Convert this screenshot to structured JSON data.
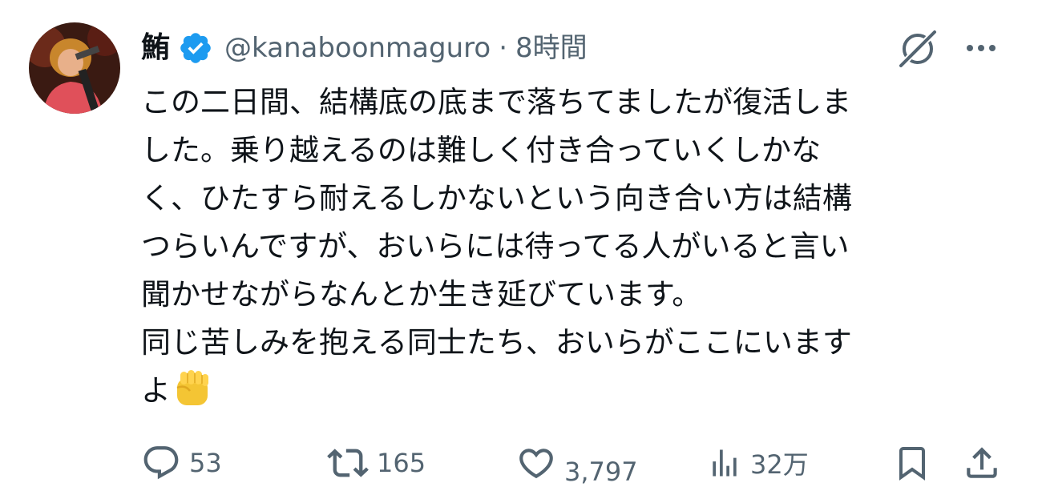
{
  "author": {
    "display_name": "鮪",
    "handle": "@kanaboonmaguro",
    "separator": "·",
    "time": "8時間",
    "verified_color": "#1d9bf0",
    "avatar_icon": "avatar"
  },
  "tweet": {
    "lines": [
      "この二日間、結構底の底まで落ちてましたが復活しま",
      "した。乗り越えるのは難しく付き合っていくしかな",
      "く、ひたすら耐えるしかないという向き合い方は結構",
      "つらいんですが、おいらには待ってる人がいると言い",
      "聞かせながらなんとか生き延びています。",
      "同じ苦しみを抱える同士たち、おいらがここにいます",
      "よ"
    ],
    "emoji": "raised-fist"
  },
  "icons": {
    "grok": "grok-icon",
    "more": "more-icon",
    "reply": "reply-icon",
    "retweet": "retweet-icon",
    "like": "like-icon",
    "views": "views-icon",
    "bookmark": "bookmark-icon",
    "share": "share-icon"
  },
  "metrics": {
    "replies": "53",
    "retweets": "165",
    "likes": "3,797",
    "views": "32万"
  },
  "colors": {
    "text": "#0f1419",
    "secondary": "#536471",
    "accent": "#1d9bf0"
  }
}
